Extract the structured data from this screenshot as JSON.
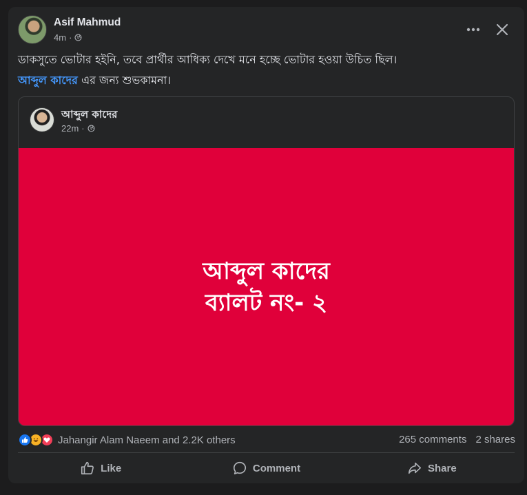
{
  "post": {
    "author": "Asif Mahmud",
    "time": "4m",
    "privacy_icon": "globe-icon",
    "text_line1": "ডাকসুতে ভোটার হইনি, তবে প্রার্থীর আধিক্য দেখে মনে হচ্ছে ভোটার হওয়া উচিত ছিল।",
    "mention": "আব্দুল কাদের",
    "text_line2_rest": " এর জন্য শুভকামনা।"
  },
  "shared_post": {
    "author": "আব্দুল কাদের",
    "time": "22m",
    "privacy_icon": "globe-icon",
    "banner_line1": "আব্দুল কাদের",
    "banner_line2": "ব্যালট নং- ২",
    "banner_color": "#e0003a"
  },
  "engagement": {
    "reactions": [
      "like-icon",
      "haha-icon",
      "love-icon"
    ],
    "reaction_text": "Jahangir Alam Naeem and 2.2K others",
    "comments": "265 comments",
    "shares": "2 shares"
  },
  "actions": {
    "like": "Like",
    "comment": "Comment",
    "share": "Share"
  },
  "colors": {
    "background": "#1c1c1d",
    "card": "#242526",
    "link": "#4599ff",
    "text_primary": "#e4e6eb",
    "text_secondary": "#b0b3b8"
  }
}
